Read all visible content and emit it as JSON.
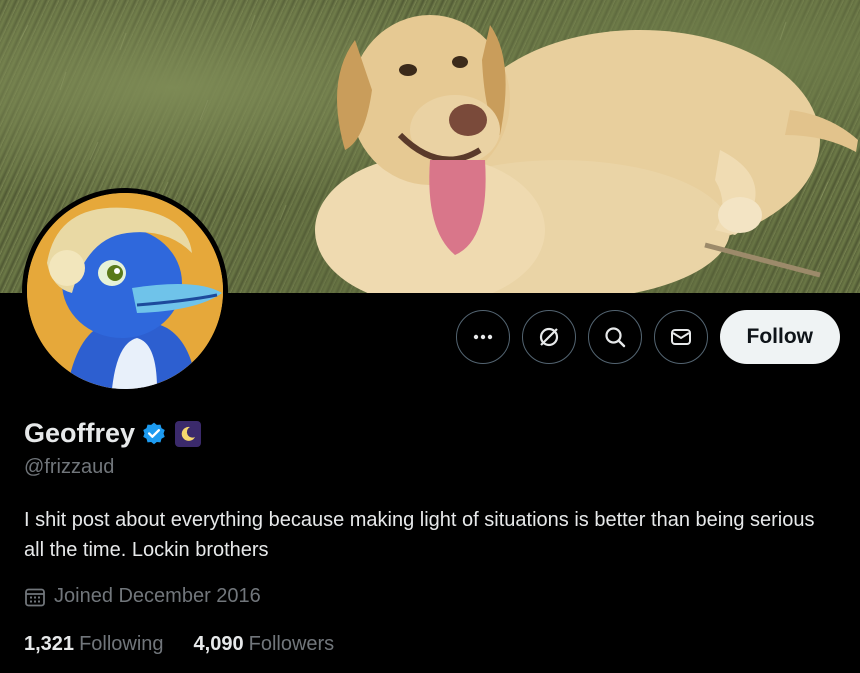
{
  "banner": {
    "image": "yellow labrador lying on grass"
  },
  "avatar": {
    "image": "cartoon blue dolphin with blond hair on orange background"
  },
  "actions": {
    "more_icon": "more-icon",
    "grok_icon": "grok-icon",
    "search_icon": "search-icon",
    "message_icon": "message-icon",
    "follow_label": "Follow"
  },
  "profile": {
    "display_name": "Geoffrey",
    "verified": true,
    "handle": "@frizzaud",
    "bio": "I shit post about everything because making light of situations is better than being serious all the time. Lockin brothers",
    "joined": "Joined December 2016"
  },
  "stats": {
    "following_count": "1,321",
    "following_label": "Following",
    "followers_count": "4,090",
    "followers_label": "Followers"
  },
  "colors": {
    "background": "#000000",
    "verified_blue": "#1d9bf0",
    "muted_text": "#71767b",
    "follow_bg": "#eff3f4"
  }
}
